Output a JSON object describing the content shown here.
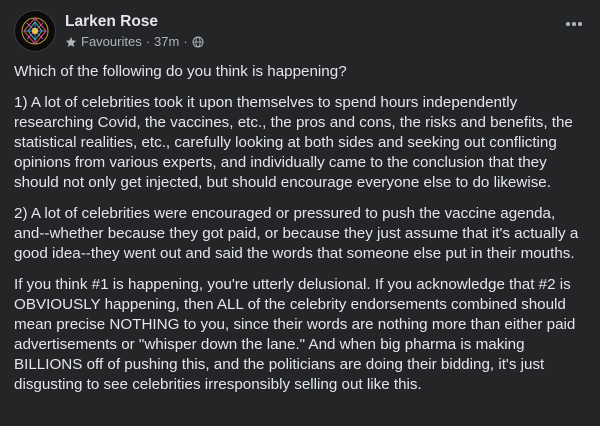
{
  "post": {
    "author": "Larken Rose",
    "audience": "Favourites",
    "separator": "·",
    "time": "37m",
    "paragraphs": [
      "Which of the following do you think is happening?",
      "1) A lot of celebrities took it upon themselves to spend hours independently researching Covid, the vaccines, etc., the pros and cons, the risks and benefits, the statistical realities, etc., carefully looking at both sides and seeking out conflicting opinions from various experts, and individually came to the conclusion that they should not only get injected, but should encourage everyone else to do likewise.",
      "2) A lot of celebrities were encouraged or pressured to push the vaccine agenda, and--whether because they got paid, or because they just assume that it's actually a good idea--they went out and said the words that someone else put in their mouths.",
      "If you think #1 is happening, you're utterly delusional. If you acknowledge that #2 is OBVIOUSLY happening, then ALL of the celebrity endorsements combined should mean precise NOTHING to you, since their words are nothing more than either paid advertisements or \"whisper down the lane.\" And when big pharma is making BILLIONS off of pushing this, and the politicians are doing their bidding, it's just disgusting to see celebrities irresponsibly selling out like this."
    ]
  },
  "icons": {
    "avatar": "geometric-symbol-avatar",
    "favourites": "star-icon",
    "privacy": "globe-icon",
    "menu": "more-options-icon"
  },
  "colors": {
    "background": "#242526",
    "primary_text": "#e4e6eb",
    "secondary_text": "#b0b3b8"
  }
}
